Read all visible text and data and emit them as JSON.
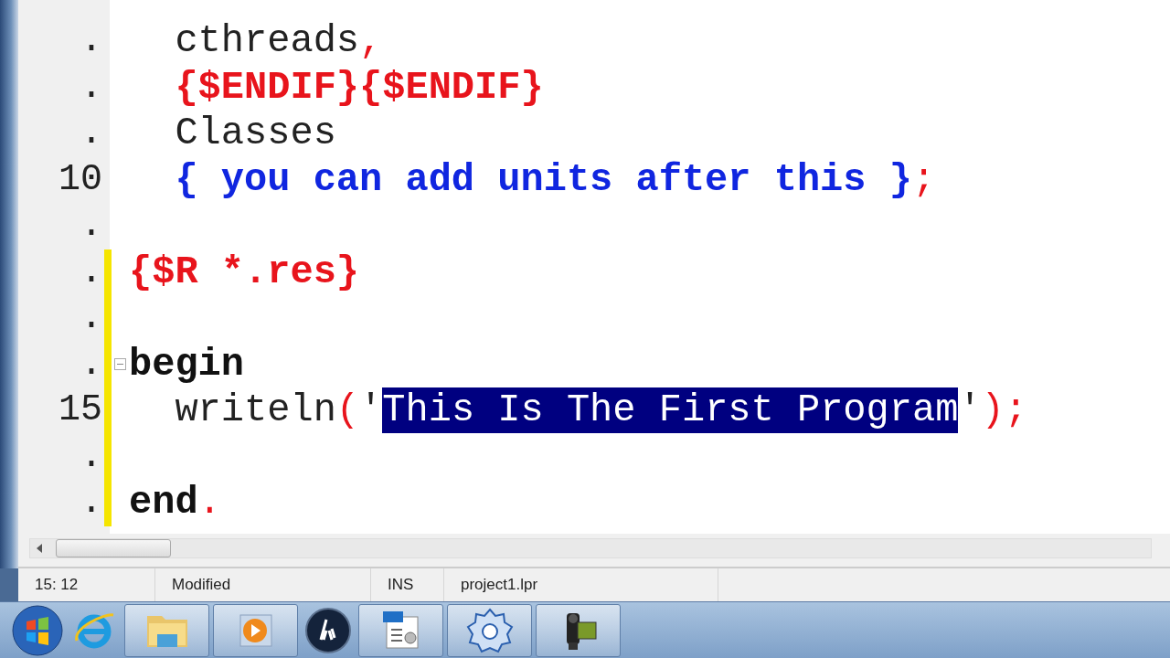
{
  "editor": {
    "lines": [
      {
        "gutter": ".",
        "modified": false,
        "fold": false,
        "tokens": [
          {
            "text": "  cthreads",
            "kind": "plain"
          },
          {
            "text": ",",
            "kind": "symbol"
          }
        ]
      },
      {
        "gutter": ".",
        "modified": false,
        "fold": false,
        "tokens": [
          {
            "text": "  {$ENDIF}{$ENDIF}",
            "kind": "directive"
          }
        ]
      },
      {
        "gutter": ".",
        "modified": false,
        "fold": false,
        "tokens": [
          {
            "text": "  Classes",
            "kind": "plain"
          }
        ]
      },
      {
        "gutter": "10",
        "modified": false,
        "fold": false,
        "tokens": [
          {
            "text": "  { you can add units after this }",
            "kind": "comment"
          },
          {
            "text": ";",
            "kind": "symbol"
          }
        ]
      },
      {
        "gutter": ".",
        "modified": false,
        "fold": false
      },
      {
        "gutter": ".",
        "modified": true,
        "fold": false,
        "tokens": [
          {
            "text": "{$R *.res}",
            "kind": "directive"
          }
        ]
      },
      {
        "gutter": ".",
        "modified": true,
        "fold": false
      },
      {
        "gutter": ".",
        "modified": true,
        "fold": true,
        "tokens": [
          {
            "text": "begin",
            "kind": "keyword"
          }
        ]
      },
      {
        "gutter": "15",
        "modified": true,
        "fold": false,
        "tokens": [
          {
            "text": "  writeln",
            "kind": "plain"
          },
          {
            "text": "(",
            "kind": "symbol"
          },
          {
            "text": "'",
            "kind": "plain"
          },
          {
            "text": "This Is The First Program",
            "kind": "selected"
          },
          {
            "text": "'",
            "kind": "plain"
          },
          {
            "text": ")",
            "kind": "symbol"
          },
          {
            "text": ";",
            "kind": "symbol"
          }
        ]
      },
      {
        "gutter": ".",
        "modified": true,
        "fold": false
      },
      {
        "gutter": ".",
        "modified": true,
        "fold": false,
        "tokens": [
          {
            "text": "end",
            "kind": "keyword"
          },
          {
            "text": ".",
            "kind": "symbol"
          }
        ]
      }
    ]
  },
  "status_bar": [
    {
      "text": "15: 12"
    },
    {
      "text": "Modified"
    },
    {
      "text": "INS"
    },
    {
      "text": "project1.lpr"
    }
  ],
  "taskbar": [
    {
      "kind": "start",
      "running": false
    },
    {
      "kind": "browser",
      "running": false
    },
    {
      "kind": "folder",
      "running": true
    },
    {
      "kind": "media",
      "running": true
    },
    {
      "kind": "printer",
      "running": false
    },
    {
      "kind": "document",
      "running": true
    },
    {
      "kind": "ide",
      "running": true
    },
    {
      "kind": "camera",
      "running": true
    }
  ]
}
